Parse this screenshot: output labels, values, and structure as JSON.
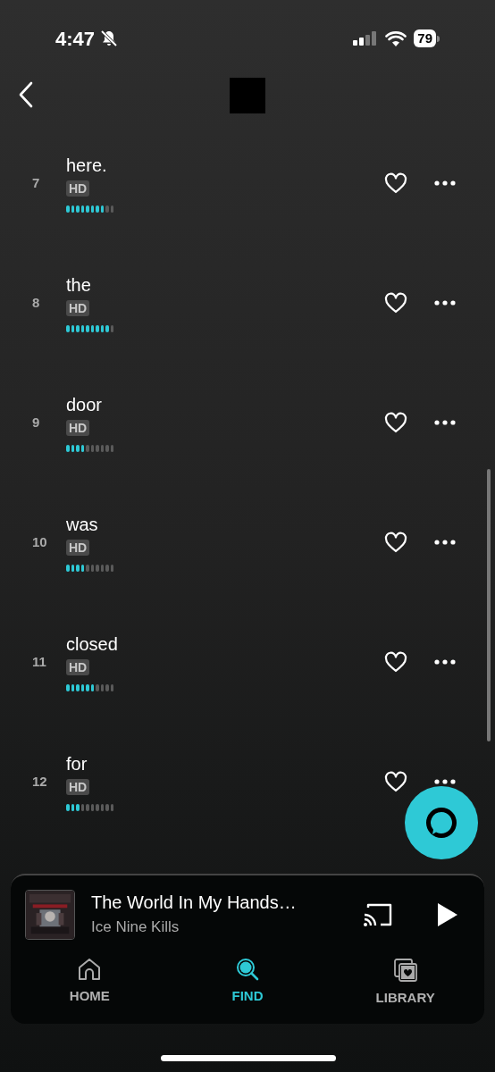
{
  "status_bar": {
    "time": "4:47",
    "battery": "79"
  },
  "tracks": [
    {
      "number": "7",
      "title": "here.",
      "badge": "HD",
      "level": 0.8
    },
    {
      "number": "8",
      "title": "the",
      "badge": "HD",
      "level": 0.9
    },
    {
      "number": "9",
      "title": "door",
      "badge": "HD",
      "level": 0.4
    },
    {
      "number": "10",
      "title": "was",
      "badge": "HD",
      "level": 0.4
    },
    {
      "number": "11",
      "title": "closed",
      "badge": "HD",
      "level": 0.6
    },
    {
      "number": "12",
      "title": "for",
      "badge": "HD",
      "level": 0.3
    }
  ],
  "now_playing": {
    "title": "The World In My Hands…",
    "artist": "Ice Nine Kills"
  },
  "nav": [
    {
      "kind": "home",
      "label": "HOME",
      "selected": false
    },
    {
      "kind": "find",
      "label": "FIND",
      "selected": true
    },
    {
      "kind": "library",
      "label": "LIBRARY",
      "selected": false
    }
  ]
}
